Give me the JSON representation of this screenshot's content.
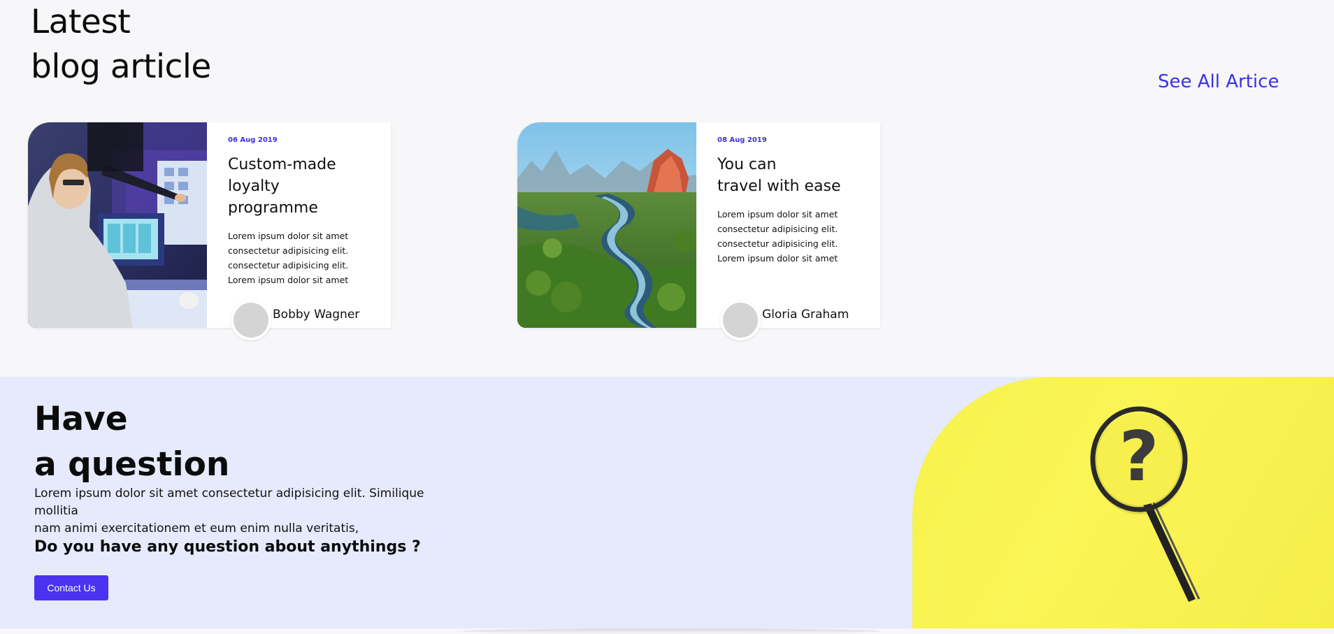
{
  "blog": {
    "title_line1": "Latest",
    "title_line2": "blog article",
    "see_all": "See All Artice",
    "cards": [
      {
        "date": "06 Aug 2019",
        "heading_line1": "Custom-made",
        "heading_line2": "loyalty programme",
        "text": [
          "Lorem ipsum dolor sit amet",
          "consectetur adipisicing elit.",
          "consectetur adipisicing elit.",
          "Lorem ipsum dolor sit amet"
        ],
        "author": "Bobby Wagner",
        "image": "person-at-computer"
      },
      {
        "date": "08 Aug 2019",
        "heading_line1": "You can",
        "heading_line2": "travel with ease",
        "text": [
          "Lorem ipsum dolor sit amet",
          "consectetur adipisicing elit.",
          "consectetur adipisicing elit.",
          "Lorem ipsum dolor sit amet"
        ],
        "author": "Gloria Graham",
        "image": "river-landscape"
      }
    ]
  },
  "question": {
    "title_line1": "Have",
    "title_line2": "a question",
    "text_line1": "Lorem ipsum dolor sit amet consectetur adipisicing elit. Similique mollitia",
    "text_line2": "nam animi exercitationem et eum enim nulla veritatis,",
    "subheading": "Do you have any question about anythings ?",
    "button_label": "Contact Us",
    "image": "magnifying-glass-question"
  },
  "colors": {
    "accent": "#4a33f0",
    "link": "#3b31e0",
    "section_bg": "#e6eafc",
    "page_bg": "#f7f7f9",
    "yellow": "#f6f24c"
  }
}
